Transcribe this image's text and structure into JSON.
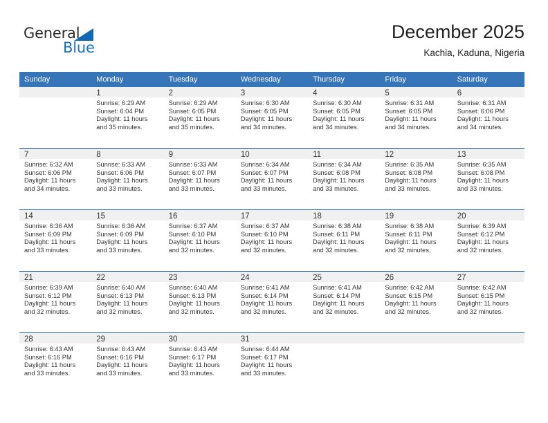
{
  "brand": {
    "name_part1": "General",
    "name_part2": "Blue",
    "accent_color": "#1773c2",
    "triangle_color": "#1168b3"
  },
  "header": {
    "title": "December 2025",
    "subtitle": "Kachia, Kaduna, Nigeria"
  },
  "calendar": {
    "header_background": "#3675b7",
    "header_text_color": "#ffffff",
    "row_divider_color": "#1f5fa4",
    "daynum_background": "#f0f0f0",
    "weekday_headers": [
      "Sunday",
      "Monday",
      "Tuesday",
      "Wednesday",
      "Thursday",
      "Friday",
      "Saturday"
    ],
    "labels": {
      "sunrise_prefix": "Sunrise:",
      "sunset_prefix": "Sunset:",
      "daylight_prefix": "Daylight:"
    },
    "weeks": [
      [
        {
          "day": "",
          "sunrise": "",
          "sunset": "",
          "daylight_line1": "",
          "daylight_line2": "",
          "empty": true
        },
        {
          "day": "1",
          "sunrise": "Sunrise: 6:29 AM",
          "sunset": "Sunset: 6:04 PM",
          "daylight_line1": "Daylight: 11 hours",
          "daylight_line2": "and 35 minutes."
        },
        {
          "day": "2",
          "sunrise": "Sunrise: 6:29 AM",
          "sunset": "Sunset: 6:05 PM",
          "daylight_line1": "Daylight: 11 hours",
          "daylight_line2": "and 35 minutes."
        },
        {
          "day": "3",
          "sunrise": "Sunrise: 6:30 AM",
          "sunset": "Sunset: 6:05 PM",
          "daylight_line1": "Daylight: 11 hours",
          "daylight_line2": "and 34 minutes."
        },
        {
          "day": "4",
          "sunrise": "Sunrise: 6:30 AM",
          "sunset": "Sunset: 6:05 PM",
          "daylight_line1": "Daylight: 11 hours",
          "daylight_line2": "and 34 minutes."
        },
        {
          "day": "5",
          "sunrise": "Sunrise: 6:31 AM",
          "sunset": "Sunset: 6:05 PM",
          "daylight_line1": "Daylight: 11 hours",
          "daylight_line2": "and 34 minutes."
        },
        {
          "day": "6",
          "sunrise": "Sunrise: 6:31 AM",
          "sunset": "Sunset: 6:06 PM",
          "daylight_line1": "Daylight: 11 hours",
          "daylight_line2": "and 34 minutes."
        }
      ],
      [
        {
          "day": "7",
          "sunrise": "Sunrise: 6:32 AM",
          "sunset": "Sunset: 6:06 PM",
          "daylight_line1": "Daylight: 11 hours",
          "daylight_line2": "and 34 minutes."
        },
        {
          "day": "8",
          "sunrise": "Sunrise: 6:33 AM",
          "sunset": "Sunset: 6:06 PM",
          "daylight_line1": "Daylight: 11 hours",
          "daylight_line2": "and 33 minutes."
        },
        {
          "day": "9",
          "sunrise": "Sunrise: 6:33 AM",
          "sunset": "Sunset: 6:07 PM",
          "daylight_line1": "Daylight: 11 hours",
          "daylight_line2": "and 33 minutes."
        },
        {
          "day": "10",
          "sunrise": "Sunrise: 6:34 AM",
          "sunset": "Sunset: 6:07 PM",
          "daylight_line1": "Daylight: 11 hours",
          "daylight_line2": "and 33 minutes."
        },
        {
          "day": "11",
          "sunrise": "Sunrise: 6:34 AM",
          "sunset": "Sunset: 6:08 PM",
          "daylight_line1": "Daylight: 11 hours",
          "daylight_line2": "and 33 minutes."
        },
        {
          "day": "12",
          "sunrise": "Sunrise: 6:35 AM",
          "sunset": "Sunset: 6:08 PM",
          "daylight_line1": "Daylight: 11 hours",
          "daylight_line2": "and 33 minutes."
        },
        {
          "day": "13",
          "sunrise": "Sunrise: 6:35 AM",
          "sunset": "Sunset: 6:08 PM",
          "daylight_line1": "Daylight: 11 hours",
          "daylight_line2": "and 33 minutes."
        }
      ],
      [
        {
          "day": "14",
          "sunrise": "Sunrise: 6:36 AM",
          "sunset": "Sunset: 6:09 PM",
          "daylight_line1": "Daylight: 11 hours",
          "daylight_line2": "and 33 minutes."
        },
        {
          "day": "15",
          "sunrise": "Sunrise: 6:36 AM",
          "sunset": "Sunset: 6:09 PM",
          "daylight_line1": "Daylight: 11 hours",
          "daylight_line2": "and 33 minutes."
        },
        {
          "day": "16",
          "sunrise": "Sunrise: 6:37 AM",
          "sunset": "Sunset: 6:10 PM",
          "daylight_line1": "Daylight: 11 hours",
          "daylight_line2": "and 32 minutes."
        },
        {
          "day": "17",
          "sunrise": "Sunrise: 6:37 AM",
          "sunset": "Sunset: 6:10 PM",
          "daylight_line1": "Daylight: 11 hours",
          "daylight_line2": "and 32 minutes."
        },
        {
          "day": "18",
          "sunrise": "Sunrise: 6:38 AM",
          "sunset": "Sunset: 6:11 PM",
          "daylight_line1": "Daylight: 11 hours",
          "daylight_line2": "and 32 minutes."
        },
        {
          "day": "19",
          "sunrise": "Sunrise: 6:38 AM",
          "sunset": "Sunset: 6:11 PM",
          "daylight_line1": "Daylight: 11 hours",
          "daylight_line2": "and 32 minutes."
        },
        {
          "day": "20",
          "sunrise": "Sunrise: 6:39 AM",
          "sunset": "Sunset: 6:12 PM",
          "daylight_line1": "Daylight: 11 hours",
          "daylight_line2": "and 32 minutes."
        }
      ],
      [
        {
          "day": "21",
          "sunrise": "Sunrise: 6:39 AM",
          "sunset": "Sunset: 6:12 PM",
          "daylight_line1": "Daylight: 11 hours",
          "daylight_line2": "and 32 minutes."
        },
        {
          "day": "22",
          "sunrise": "Sunrise: 6:40 AM",
          "sunset": "Sunset: 6:13 PM",
          "daylight_line1": "Daylight: 11 hours",
          "daylight_line2": "and 32 minutes."
        },
        {
          "day": "23",
          "sunrise": "Sunrise: 6:40 AM",
          "sunset": "Sunset: 6:13 PM",
          "daylight_line1": "Daylight: 11 hours",
          "daylight_line2": "and 32 minutes."
        },
        {
          "day": "24",
          "sunrise": "Sunrise: 6:41 AM",
          "sunset": "Sunset: 6:14 PM",
          "daylight_line1": "Daylight: 11 hours",
          "daylight_line2": "and 32 minutes."
        },
        {
          "day": "25",
          "sunrise": "Sunrise: 6:41 AM",
          "sunset": "Sunset: 6:14 PM",
          "daylight_line1": "Daylight: 11 hours",
          "daylight_line2": "and 32 minutes."
        },
        {
          "day": "26",
          "sunrise": "Sunrise: 6:42 AM",
          "sunset": "Sunset: 6:15 PM",
          "daylight_line1": "Daylight: 11 hours",
          "daylight_line2": "and 32 minutes."
        },
        {
          "day": "27",
          "sunrise": "Sunrise: 6:42 AM",
          "sunset": "Sunset: 6:15 PM",
          "daylight_line1": "Daylight: 11 hours",
          "daylight_line2": "and 32 minutes."
        }
      ],
      [
        {
          "day": "28",
          "sunrise": "Sunrise: 6:43 AM",
          "sunset": "Sunset: 6:16 PM",
          "daylight_line1": "Daylight: 11 hours",
          "daylight_line2": "and 33 minutes."
        },
        {
          "day": "29",
          "sunrise": "Sunrise: 6:43 AM",
          "sunset": "Sunset: 6:16 PM",
          "daylight_line1": "Daylight: 11 hours",
          "daylight_line2": "and 33 minutes."
        },
        {
          "day": "30",
          "sunrise": "Sunrise: 6:43 AM",
          "sunset": "Sunset: 6:17 PM",
          "daylight_line1": "Daylight: 11 hours",
          "daylight_line2": "and 33 minutes."
        },
        {
          "day": "31",
          "sunrise": "Sunrise: 6:44 AM",
          "sunset": "Sunset: 6:17 PM",
          "daylight_line1": "Daylight: 11 hours",
          "daylight_line2": "and 33 minutes."
        },
        {
          "day": "",
          "sunrise": "",
          "sunset": "",
          "daylight_line1": "",
          "daylight_line2": "",
          "empty": true
        },
        {
          "day": "",
          "sunrise": "",
          "sunset": "",
          "daylight_line1": "",
          "daylight_line2": "",
          "empty": true
        },
        {
          "day": "",
          "sunrise": "",
          "sunset": "",
          "daylight_line1": "",
          "daylight_line2": "",
          "empty": true
        }
      ]
    ]
  }
}
